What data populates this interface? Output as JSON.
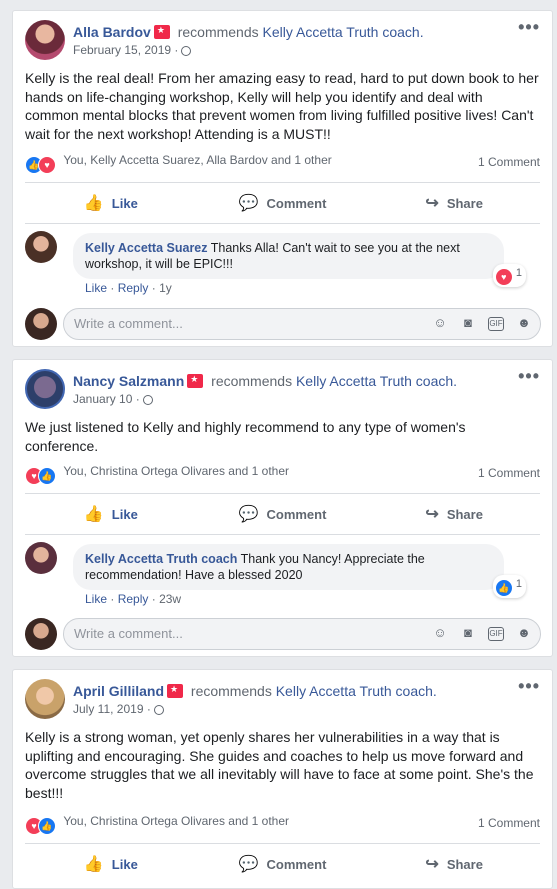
{
  "posts": [
    {
      "author": "Alla Bardov",
      "recommends": "recommends",
      "page": "Kelly Accetta Truth coach.",
      "date": "February 15, 2019 ·",
      "text": "Kelly is the real deal! From her amazing easy to read, hard to put down book to her hands on life-changing workshop, Kelly will help you identify and deal with common mental blocks that prevent women from living fulfilled positive lives! Can't wait for the next workshop! Attending is a MUST!!",
      "reactions_text": "You, Kelly Accetta Suarez, Alla Bardov and 1 other",
      "comment_count": "1 Comment",
      "reply": {
        "author": "Kelly Accetta Suarez",
        "text": "Thanks Alla! Can't wait to see you at the next workshop, it will be EPIC!!!",
        "reaction_count": "1",
        "time": "1y"
      }
    },
    {
      "author": "Nancy Salzmann",
      "recommends": "recommends",
      "page": "Kelly Accetta Truth coach.",
      "date": "January 10 ·",
      "text": "We just listened to Kelly and highly recommend to any type of women's conference.",
      "reactions_text": "You, Christina Ortega Olivares and 1 other",
      "comment_count": "1 Comment",
      "reply": {
        "author": "Kelly Accetta Truth coach",
        "text": "Thank you Nancy! Appreciate the recommendation! Have a blessed 2020",
        "reaction_count": "1",
        "time": "23w"
      }
    },
    {
      "author": "April Gilliland",
      "recommends": "recommends",
      "page": "Kelly Accetta Truth coach.",
      "date": "July 11, 2019 ·",
      "text": "Kelly is a strong woman, yet openly shares her vulnerabilities in a way that is uplifting and encouraging. She guides and coaches to help us move forward and overcome struggles that we all inevitably will have to face at some point. She's the best!!!",
      "reactions_text": "You, Christina Ortega Olivares and 1 other",
      "comment_count": "1 Comment"
    }
  ],
  "actions": {
    "like": "Like",
    "comment": "Comment",
    "share": "Share"
  },
  "reply_links": {
    "like": "Like",
    "reply": "Reply",
    "sep": "·"
  },
  "write_placeholder": "Write a comment...",
  "more_label": "•••",
  "colors": {
    "link": "#385898",
    "like_blue": "#1877f2",
    "love_red": "#f33e58",
    "badge_red": "#f02849"
  },
  "icons": [
    "thumbs-up-icon",
    "comment-icon",
    "share-icon",
    "globe-icon",
    "emoji-icon",
    "camera-icon",
    "gif-icon",
    "sticker-icon",
    "recommend-badge-icon",
    "more-icon"
  ]
}
